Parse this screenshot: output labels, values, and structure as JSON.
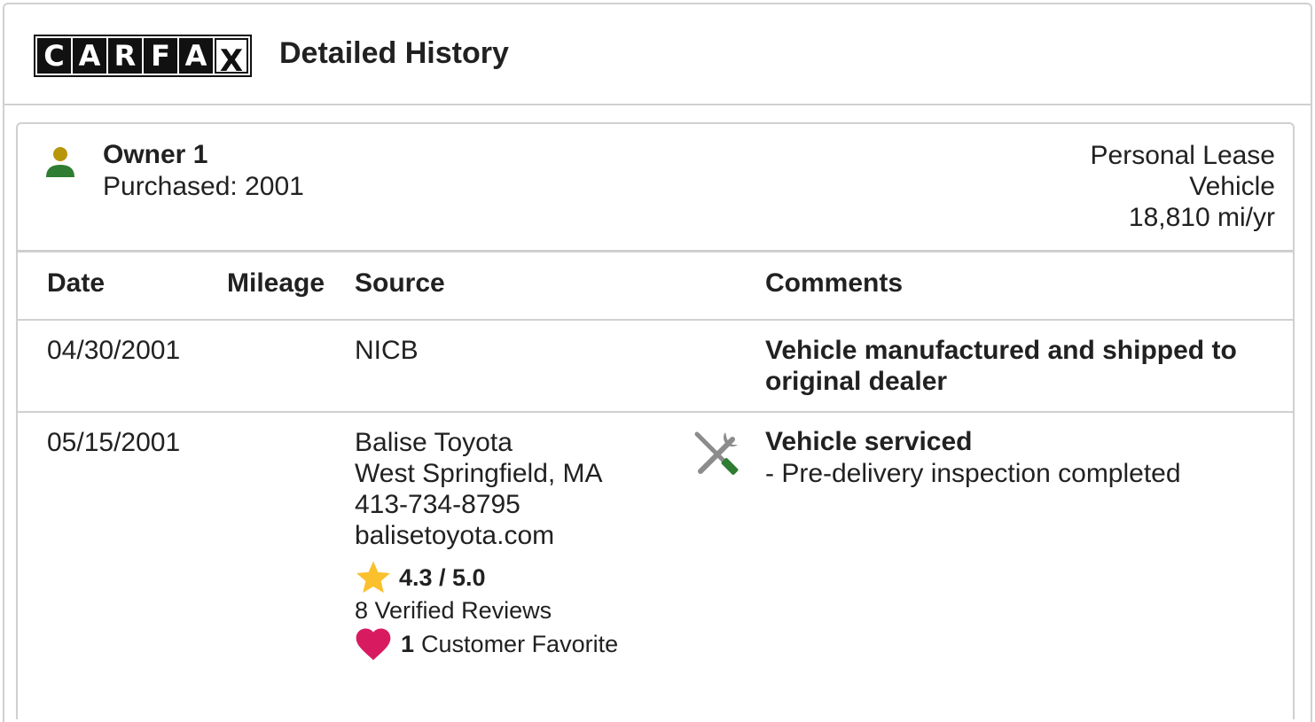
{
  "header": {
    "logo_letters": [
      "C",
      "A",
      "R",
      "F",
      "A",
      "X"
    ],
    "title": "Detailed History"
  },
  "owner": {
    "name": "Owner 1",
    "purchased": "Purchased: 2001",
    "type_line1": "Personal Lease",
    "type_line2": "Vehicle",
    "mileage_rate": "18,810 mi/yr"
  },
  "table": {
    "columns": [
      "Date",
      "Mileage",
      "Source",
      "Comments"
    ],
    "rows": [
      {
        "date": "04/30/2001",
        "mileage": "",
        "source": "NICB",
        "comment_line1": "Vehicle manufactured and shipped to",
        "comment_line2": "original dealer"
      },
      {
        "date": "05/15/2001",
        "mileage": "",
        "source_name": "Balise Toyota",
        "source_city": "West Springfield, MA",
        "source_phone": "413-734-8795",
        "source_web": "balisetoyota.com",
        "rating": "4.3 / 5.0",
        "reviews": "8 Verified Reviews",
        "favorite_count": "1",
        "favorite_label": "Customer Favorite",
        "comment_title": "Vehicle serviced",
        "comment_detail": "- Pre-delivery inspection completed"
      }
    ]
  },
  "colors": {
    "owner_head": "#b8960a",
    "owner_body": "#2e7d32",
    "star": "#fbc02d",
    "heart": "#d81b60",
    "tool_gray": "#8c8c8c",
    "tool_green": "#2e7d32"
  },
  "icons": {
    "owner": "person-icon",
    "star": "star-icon",
    "heart": "heart-icon",
    "service": "wrench-screwdriver-icon"
  }
}
